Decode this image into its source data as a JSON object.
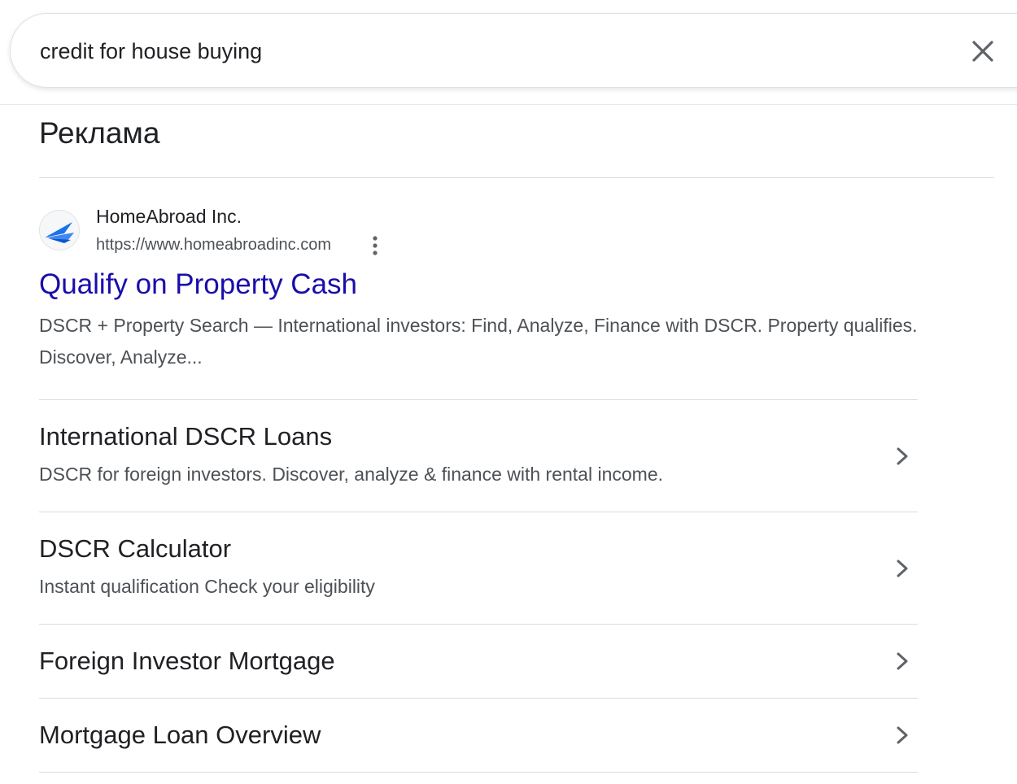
{
  "search": {
    "query": "credit for house buying",
    "clear_icon": "close-icon"
  },
  "ads": {
    "label": "Реклама",
    "advertiser": {
      "name": "HomeAbroad Inc.",
      "url": "https://www.homeabroadinc.com",
      "favicon_icon": "homeabroad-logo-icon",
      "more_icon": "more-vert-icon"
    },
    "headline": "Qualify on Property Cash",
    "description": "DSCR + Property Search — International investors: Find, Analyze, Finance with DSCR. Property qualifies. Discover, Analyze...",
    "sitelinks": [
      {
        "title": "International DSCR Loans",
        "description": "DSCR for foreign investors. Discover, analyze & finance with rental income."
      },
      {
        "title": "DSCR Calculator",
        "description": "Instant qualification Check your eligibility"
      },
      {
        "title": "Foreign Investor Mortgage"
      },
      {
        "title": "Mortgage Loan Overview"
      }
    ]
  },
  "colors": {
    "link": "#1a0dab",
    "text_primary": "#202124",
    "text_secondary": "#4d5156",
    "divider": "#dadce0",
    "logo_blue": "#1a73e8"
  }
}
